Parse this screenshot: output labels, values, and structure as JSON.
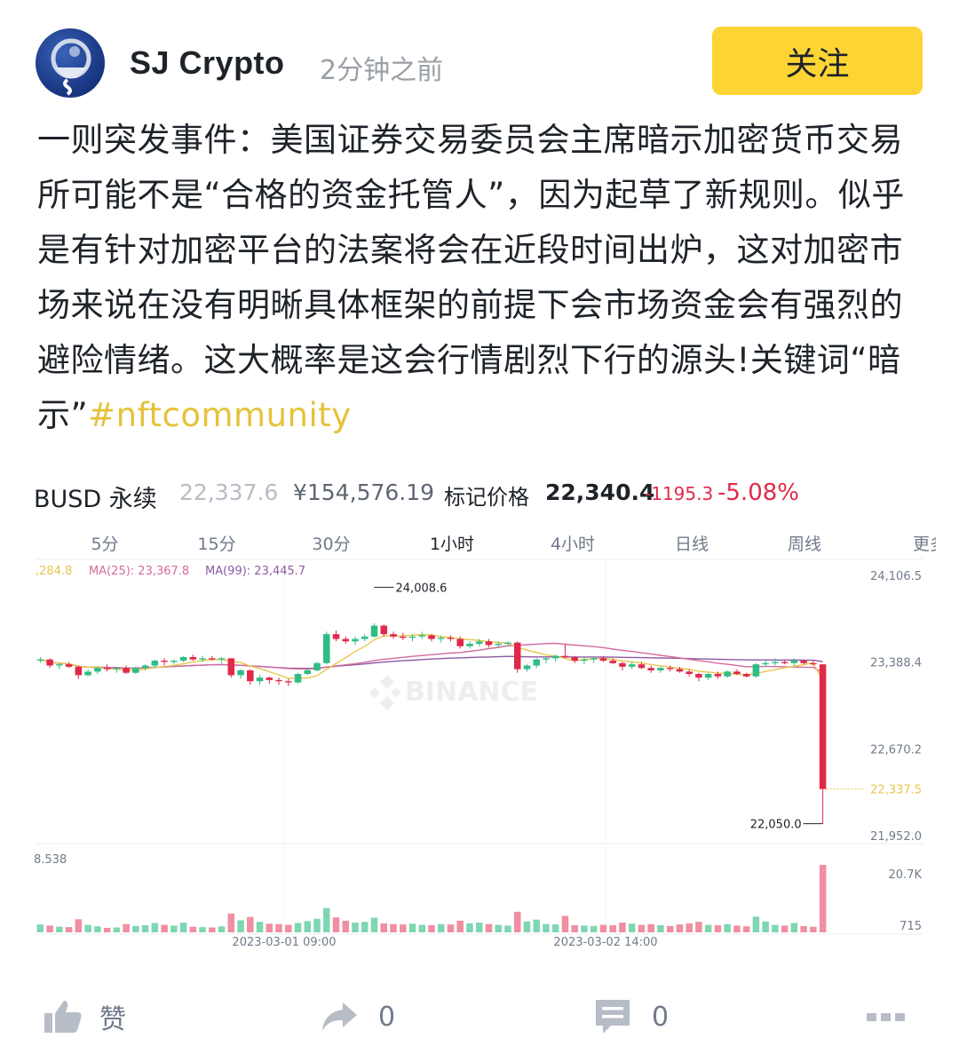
{
  "post": {
    "author": "SJ Crypto",
    "time": "2分钟之前",
    "follow_label": "关注",
    "body": "一则突发事件：美国证券交易委员会主席暗示加密货币交易所可能不是“合格的资金托管人”，因为起草了新规则。似乎是有针对加密平台的法案将会在近段时间出炉，这对加密市场来说在没有明晰具体框架的前提下会市场资金会有强烈的避险情绪。这大概率是这会行情剧烈下行的源头!关键词“暗示”",
    "hashtag": "#nftcommunity"
  },
  "ticker": {
    "pair": "BUSD 永续",
    "last_price": "22,337.6",
    "cny_price": "¥154,576.19",
    "mark_label": "标记价格",
    "mark_price": "22,340.4",
    "change": "-1195.3",
    "change_pct": "-5.08%"
  },
  "intervals": {
    "items": [
      "5分",
      "15分",
      "30分",
      "1小时",
      "4小时",
      "日线",
      "周线",
      "更多"
    ],
    "active": "1小时"
  },
  "ma_labels": {
    "ma7": ",284.8",
    "ma25": "MA(25): 23,367.8",
    "ma99": "MA(99): 23,445.7"
  },
  "chart_data": {
    "type": "candlestick",
    "watermark": "BINANCE",
    "y_ticks": [
      "24,106.5",
      "23,388.4",
      "22,670.2",
      "21,952.0"
    ],
    "y_tick_values": [
      24106.5,
      23388.4,
      22670.2,
      21952.0
    ],
    "ylim": [
      21952.0,
      24106.5
    ],
    "current_price": 22337.5,
    "current_price_label": "22,337.5",
    "high_annotation": {
      "value": 24008.6,
      "label": "24,008.6"
    },
    "low_annotation": {
      "value": 22050.0,
      "label": "22,050.0"
    },
    "x_time_labels": [
      "2023-03-01 09:00",
      "2023-03-02 14:00"
    ],
    "volume_ticks": [
      "20.7K",
      "715"
    ],
    "volume_left_label": "8.538",
    "candles_ohlc": [
      [
        23400,
        23430,
        23380,
        23410
      ],
      [
        23410,
        23420,
        23340,
        23360
      ],
      [
        23360,
        23380,
        23330,
        23370
      ],
      [
        23370,
        23390,
        23340,
        23350
      ],
      [
        23350,
        23360,
        23250,
        23280
      ],
      [
        23280,
        23330,
        23270,
        23310
      ],
      [
        23310,
        23350,
        23290,
        23340
      ],
      [
        23340,
        23370,
        23310,
        23330
      ],
      [
        23330,
        23350,
        23300,
        23340
      ],
      [
        23340,
        23360,
        23290,
        23300
      ],
      [
        23300,
        23350,
        23290,
        23340
      ],
      [
        23340,
        23370,
        23320,
        23360
      ],
      [
        23360,
        23410,
        23340,
        23400
      ],
      [
        23400,
        23420,
        23360,
        23390
      ],
      [
        23390,
        23410,
        23370,
        23400
      ],
      [
        23400,
        23440,
        23390,
        23430
      ],
      [
        23430,
        23450,
        23400,
        23410
      ],
      [
        23410,
        23440,
        23390,
        23420
      ],
      [
        23420,
        23440,
        23400,
        23410
      ],
      [
        23410,
        23430,
        23380,
        23420
      ],
      [
        23420,
        23420,
        23260,
        23280
      ],
      [
        23280,
        23330,
        23250,
        23320
      ],
      [
        23320,
        23330,
        23200,
        23230
      ],
      [
        23230,
        23280,
        23200,
        23260
      ],
      [
        23260,
        23270,
        23210,
        23240
      ],
      [
        23240,
        23260,
        23200,
        23230
      ],
      [
        23230,
        23250,
        23190,
        23220
      ],
      [
        23220,
        23300,
        23210,
        23290
      ],
      [
        23290,
        23340,
        23280,
        23320
      ],
      [
        23320,
        23390,
        23310,
        23380
      ],
      [
        23380,
        23640,
        23370,
        23620
      ],
      [
        23620,
        23650,
        23560,
        23580
      ],
      [
        23580,
        23600,
        23540,
        23560
      ],
      [
        23560,
        23600,
        23530,
        23580
      ],
      [
        23580,
        23620,
        23560,
        23600
      ],
      [
        23600,
        23710,
        23590,
        23690
      ],
      [
        23690,
        23700,
        23600,
        23620
      ],
      [
        23620,
        23640,
        23580,
        23600
      ],
      [
        23600,
        23630,
        23570,
        23590
      ],
      [
        23590,
        23620,
        23560,
        23600
      ],
      [
        23600,
        23640,
        23580,
        23610
      ],
      [
        23610,
        23620,
        23560,
        23580
      ],
      [
        23580,
        23610,
        23550,
        23590
      ],
      [
        23590,
        23610,
        23560,
        23580
      ],
      [
        23580,
        23600,
        23500,
        23520
      ],
      [
        23520,
        23560,
        23500,
        23540
      ],
      [
        23540,
        23580,
        23520,
        23560
      ],
      [
        23560,
        23580,
        23510,
        23530
      ],
      [
        23530,
        23560,
        23510,
        23540
      ],
      [
        23540,
        23560,
        23520,
        23550
      ],
      [
        23550,
        23560,
        23300,
        23330
      ],
      [
        23330,
        23370,
        23310,
        23360
      ],
      [
        23360,
        23420,
        23340,
        23410
      ],
      [
        23410,
        23430,
        23380,
        23420
      ],
      [
        23420,
        23450,
        23390,
        23440
      ],
      [
        23440,
        23540,
        23420,
        23430
      ],
      [
        23430,
        23440,
        23380,
        23400
      ],
      [
        23400,
        23430,
        23370,
        23410
      ],
      [
        23410,
        23430,
        23380,
        23420
      ],
      [
        23420,
        23440,
        23390,
        23400
      ],
      [
        23400,
        23420,
        23370,
        23380
      ],
      [
        23380,
        23390,
        23320,
        23350
      ],
      [
        23350,
        23390,
        23330,
        23370
      ],
      [
        23370,
        23390,
        23330,
        23340
      ],
      [
        23340,
        23360,
        23300,
        23320
      ],
      [
        23320,
        23350,
        23300,
        23340
      ],
      [
        23340,
        23360,
        23310,
        23330
      ],
      [
        23330,
        23350,
        23300,
        23310
      ],
      [
        23310,
        23330,
        23270,
        23290
      ],
      [
        23290,
        23300,
        23230,
        23260
      ],
      [
        23260,
        23300,
        23240,
        23290
      ],
      [
        23290,
        23310,
        23250,
        23270
      ],
      [
        23270,
        23320,
        23260,
        23310
      ],
      [
        23310,
        23330,
        23280,
        23290
      ],
      [
        23290,
        23300,
        23260,
        23270
      ],
      [
        23270,
        23380,
        23260,
        23370
      ],
      [
        23370,
        23400,
        23350,
        23380
      ],
      [
        23380,
        23420,
        23360,
        23390
      ],
      [
        23390,
        23410,
        23370,
        23380
      ],
      [
        23380,
        23420,
        23360,
        23400
      ],
      [
        23400,
        23410,
        23370,
        23380
      ],
      [
        23380,
        23400,
        23360,
        23370
      ],
      [
        23370,
        23370,
        22050,
        22337.5
      ]
    ],
    "volumes": [
      2.1,
      1.8,
      1.5,
      1.4,
      3.5,
      2.0,
      1.6,
      1.2,
      1.3,
      2.2,
      1.7,
      1.9,
      2.5,
      2.0,
      1.8,
      2.6,
      1.5,
      1.4,
      1.3,
      1.6,
      5.0,
      3.2,
      4.1,
      2.8,
      2.3,
      2.2,
      2.0,
      2.5,
      3.0,
      3.6,
      6.5,
      4.0,
      3.1,
      2.6,
      2.8,
      3.9,
      2.4,
      2.2,
      2.1,
      2.3,
      2.0,
      1.9,
      2.2,
      2.1,
      3.1,
      2.4,
      2.6,
      2.2,
      2.0,
      1.8,
      5.5,
      2.9,
      3.4,
      2.2,
      2.1,
      4.4,
      1.9,
      1.8,
      1.7,
      2.0,
      1.9,
      2.6,
      2.3,
      2.0,
      2.2,
      1.9,
      1.7,
      2.1,
      2.4,
      2.8,
      2.0,
      1.9,
      2.2,
      1.8,
      1.6,
      4.2,
      2.9,
      2.0,
      1.8,
      2.5,
      1.7,
      1.5,
      18.0
    ]
  },
  "footer": {
    "like_label": "赞",
    "share_count": "0",
    "comment_count": "0"
  },
  "colors": {
    "up": "#2ebd85",
    "down": "#e0294a",
    "brand_yellow": "#fcd535",
    "ma7": "#e8c64c",
    "ma25": "#d36b9e",
    "ma99": "#8d5aa4"
  }
}
